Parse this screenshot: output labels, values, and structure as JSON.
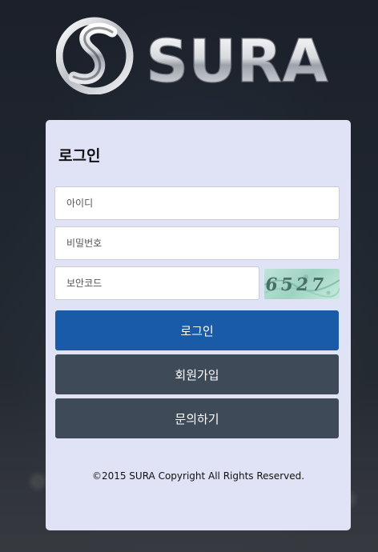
{
  "brand": {
    "logo_text": "SURA"
  },
  "login_panel": {
    "title": "로그인",
    "id_placeholder": "아이디",
    "password_placeholder": "비밀번호",
    "captcha_placeholder": "보안코드",
    "captcha_text": "6527",
    "login_button": "로그인",
    "join_button": "회원가입",
    "inquiry_button": "문의하기"
  },
  "footer": {
    "copyright": "©2015 SURA Copyright All Rights Reserved."
  },
  "colors": {
    "panel_background": "#dfe3f5",
    "login_button": "#1a5ba8",
    "secondary_button": "#3f4a58"
  }
}
